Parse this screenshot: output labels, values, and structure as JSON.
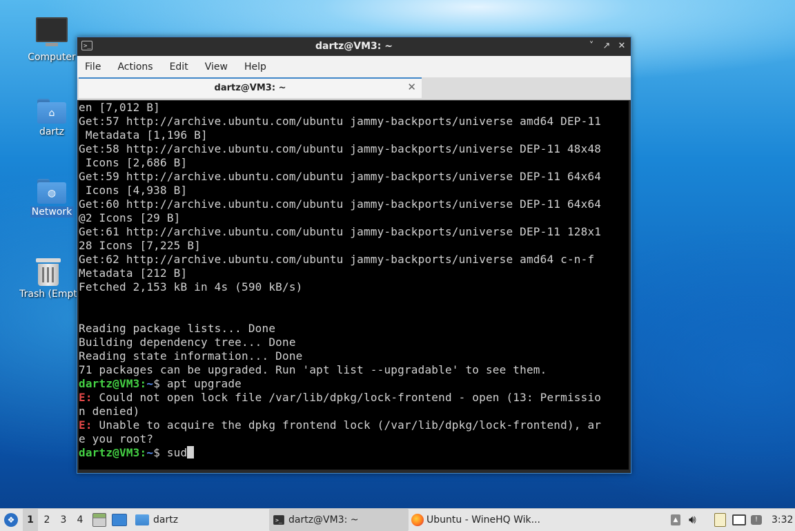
{
  "desktop": {
    "icons": [
      {
        "label": "Computer"
      },
      {
        "label": "dartz"
      },
      {
        "label": "Network"
      },
      {
        "label": "Trash (Empt"
      }
    ]
  },
  "window": {
    "title": "dartz@VM3: ~",
    "controls": {
      "minimize": "˅",
      "maximize": "↗",
      "close": "✕"
    },
    "menu": [
      "File",
      "Actions",
      "Edit",
      "View",
      "Help"
    ],
    "tab": {
      "label": "dartz@VM3: ~",
      "close": "✕"
    }
  },
  "terminal": {
    "prompt_user": "dartz@VM3",
    "prompt_path": "~",
    "lines": [
      "en [7,012 B]",
      "Get:57 http://archive.ubuntu.com/ubuntu jammy-backports/universe amd64 DEP-11",
      " Metadata [1,196 B]",
      "Get:58 http://archive.ubuntu.com/ubuntu jammy-backports/universe DEP-11 48x48",
      " Icons [2,686 B]",
      "Get:59 http://archive.ubuntu.com/ubuntu jammy-backports/universe DEP-11 64x64",
      " Icons [4,938 B]",
      "Get:60 http://archive.ubuntu.com/ubuntu jammy-backports/universe DEP-11 64x64",
      "@2 Icons [29 B]",
      "Get:61 http://archive.ubuntu.com/ubuntu jammy-backports/universe DEP-11 128x1",
      "28 Icons [7,225 B]",
      "Get:62 http://archive.ubuntu.com/ubuntu jammy-backports/universe amd64 c-n-f",
      "Metadata [212 B]",
      "Fetched 2,153 kB in 4s (590 kB/s)",
      "",
      "",
      "Reading package lists... Done",
      "Building dependency tree... Done",
      "Reading state information... Done",
      "71 packages can be upgraded. Run 'apt list --upgradable' to see them."
    ],
    "cmd1": "$ apt upgrade",
    "err_prefix": "E:",
    "err1a": " Could not open lock file /var/lib/dpkg/lock-frontend - open (13: Permissio",
    "err1b": "n denied)",
    "err2a": " Unable to acquire the dpkg frontend lock (/var/lib/dpkg/lock-frontend), ar",
    "err2b": "e you root?",
    "cmd2": "$ sud"
  },
  "taskbar": {
    "workspaces": [
      "1",
      "2",
      "3",
      "4"
    ],
    "active_workspace": "1",
    "tasks": [
      {
        "label": "dartz"
      },
      {
        "label": "dartz@VM3: ~"
      },
      {
        "label": "Ubuntu - WineHQ Wik..."
      }
    ],
    "clock": "3:32"
  }
}
